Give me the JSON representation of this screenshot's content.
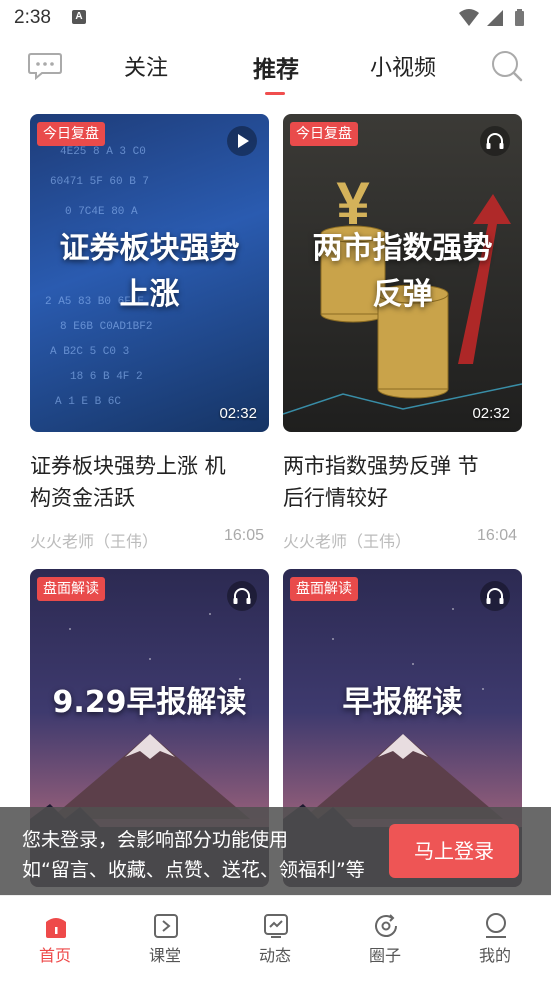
{
  "status_bar": {
    "time": "2:38",
    "notification": "A"
  },
  "header": {
    "tabs": [
      {
        "label": "关注"
      },
      {
        "label": "推荐",
        "active": true
      },
      {
        "label": "小视频"
      }
    ],
    "chat_icon": "chat-bubble-icon",
    "search_icon": "search-icon"
  },
  "feed": [
    {
      "badge": "今日复盘",
      "thumb_line1": "证券板块强势",
      "thumb_line2": "上涨",
      "media_type": "play-icon",
      "duration": "02:32",
      "title_line1": "证券板块强势上涨  机",
      "title_line2": "构资金活跃",
      "author": "火火老师（王伟）",
      "time": "16:05"
    },
    {
      "badge": "今日复盘",
      "thumb_line1": "两市指数强势",
      "thumb_line2": "反弹",
      "media_type": "headphones-icon",
      "duration": "02:32",
      "title_line1": "两市指数强势反弹   节",
      "title_line2": "后行情较好",
      "author": "火火老师（王伟）",
      "time": "16:04"
    },
    {
      "badge": "盘面解读",
      "thumb_line1": "9.29早报解读",
      "media_type": "headphones-icon",
      "duration": ""
    },
    {
      "badge": "盘面解读",
      "thumb_line1": "早报解读",
      "media_type": "headphones-icon",
      "duration": ""
    }
  ],
  "login_banner": {
    "line1": "您未登录，会影响部分功能使用",
    "line2": "如“留言、收藏、点赞、送花、领福利”等",
    "button": "马上登录"
  },
  "bottom_nav": [
    {
      "label": "首页",
      "icon": "home-icon",
      "active": true
    },
    {
      "label": "课堂",
      "icon": "classroom-icon"
    },
    {
      "label": "动态",
      "icon": "trend-icon"
    },
    {
      "label": "圈子",
      "icon": "circle-icon"
    },
    {
      "label": "我的",
      "icon": "profile-icon"
    }
  ],
  "colors": {
    "accent": "#ee4a4a",
    "banner_bg": "#505050"
  }
}
